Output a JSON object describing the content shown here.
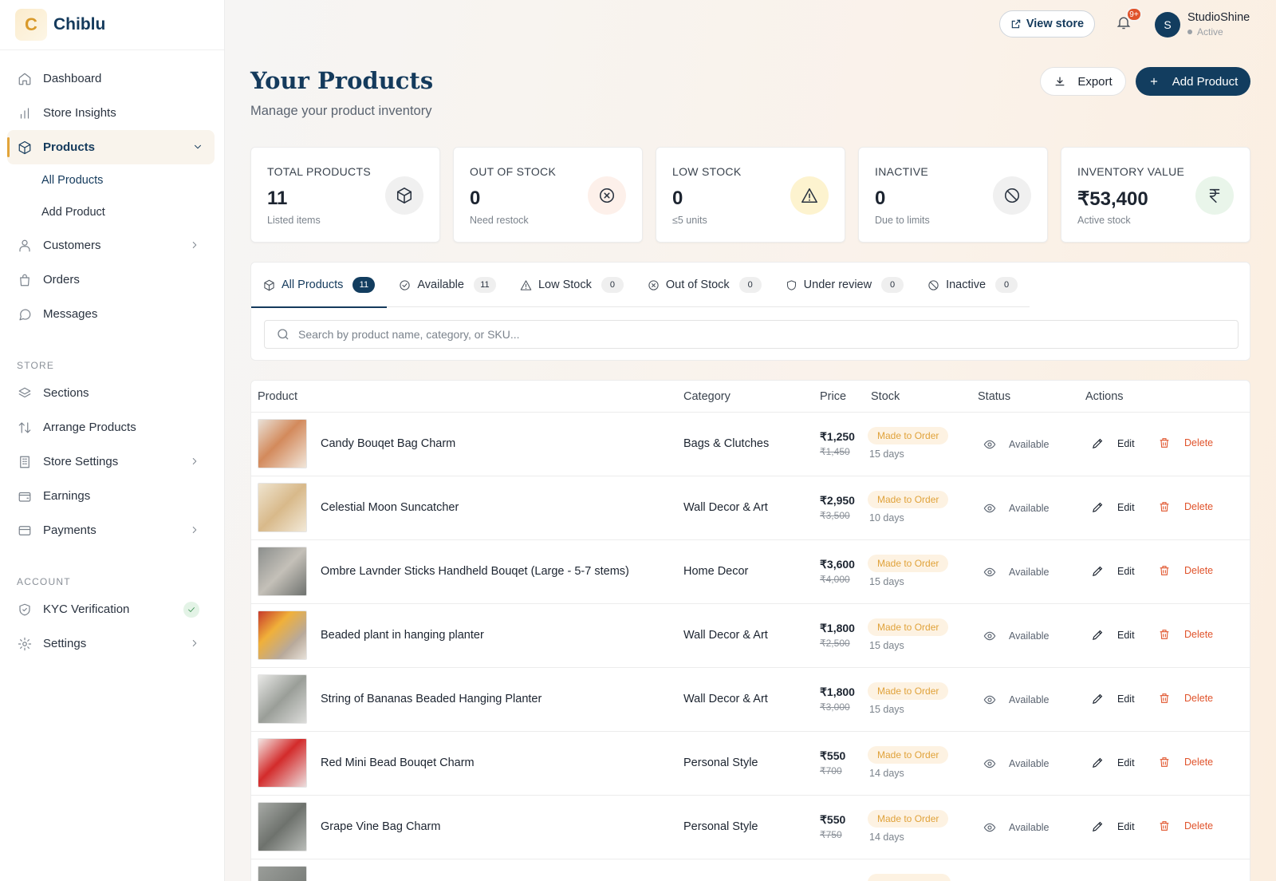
{
  "brand": {
    "logo_letter": "C",
    "name": "Chiblu"
  },
  "sidebar": {
    "items_main": [
      {
        "label": "Dashboard",
        "icon": "home-icon"
      },
      {
        "label": "Store Insights",
        "icon": "bar-chart-icon"
      }
    ],
    "products": {
      "label": "Products",
      "icon": "box-icon",
      "sub": [
        "All Products",
        "Add Product"
      ]
    },
    "items_main2": [
      {
        "label": "Customers",
        "icon": "users-icon"
      },
      {
        "label": "Orders",
        "icon": "bag-icon"
      },
      {
        "label": "Messages",
        "icon": "chat-icon"
      }
    ],
    "store_label": "STORE",
    "store_items": [
      {
        "label": "Sections",
        "icon": "layers-icon"
      },
      {
        "label": "Arrange Products",
        "icon": "sort-icon"
      },
      {
        "label": "Store Settings",
        "icon": "building-icon"
      },
      {
        "label": "Earnings",
        "icon": "wallet-icon"
      },
      {
        "label": "Payments",
        "icon": "card-icon"
      }
    ],
    "account_label": "ACCOUNT",
    "account_items": [
      {
        "label": "KYC Verification",
        "icon": "shield-icon"
      },
      {
        "label": "Settings",
        "icon": "gear-icon"
      }
    ]
  },
  "topbar": {
    "view_store": "View store",
    "notification_count": "9+",
    "avatar_letter": "S",
    "user_name": "StudioShine",
    "user_status": "Active"
  },
  "page": {
    "title": "Your Products",
    "subtitle": "Manage your product inventory",
    "export_label": "Export",
    "add_label": "Add Product"
  },
  "stats": [
    {
      "label": "TOTAL PRODUCTS",
      "value": "11",
      "note": "Listed items",
      "icon": "box-icon",
      "icon_bg": "#f0f0f0"
    },
    {
      "label": "OUT OF STOCK",
      "value": "0",
      "note": "Need restock",
      "icon": "x-circle-icon",
      "icon_bg": "#fdf0ea"
    },
    {
      "label": "LOW STOCK",
      "value": "0",
      "note": "≤5 units",
      "icon": "warning-icon",
      "icon_bg": "#fdf3cf"
    },
    {
      "label": "INACTIVE",
      "value": "0",
      "note": "Due to limits",
      "icon": "ban-icon",
      "icon_bg": "#f0f0f0"
    },
    {
      "label": "INVENTORY VALUE",
      "value": "₹53,400",
      "note": "Active stock",
      "icon": "rupee-icon",
      "icon_bg": "#e9f5ea"
    }
  ],
  "tabs": [
    {
      "label": "All Products",
      "count": "11",
      "icon": "box-icon"
    },
    {
      "label": "Available",
      "count": "11",
      "icon": "check-circle-icon"
    },
    {
      "label": "Low Stock",
      "count": "0",
      "icon": "warning-icon"
    },
    {
      "label": "Out of Stock",
      "count": "0",
      "icon": "x-circle-icon"
    },
    {
      "label": "Under review",
      "count": "0",
      "icon": "shield-icon"
    },
    {
      "label": "Inactive",
      "count": "0",
      "icon": "ban-icon"
    }
  ],
  "search": {
    "placeholder": "Search by product name, category, or SKU..."
  },
  "table": {
    "headers": {
      "product": "Product",
      "category": "Category",
      "price": "Price",
      "stock": "Stock",
      "status": "Status",
      "actions": "Actions"
    },
    "edit_label": "Edit",
    "delete_label": "Delete",
    "rows": [
      {
        "name": "Candy Bouqet Bag Charm",
        "category": "Bags & Clutches",
        "price": "₹1,250",
        "old_price": "₹1,450",
        "stock_badge": "Made to Order",
        "stock_days": "15 days",
        "status": "Available"
      },
      {
        "name": "Celestial Moon Suncatcher",
        "category": "Wall Decor & Art",
        "price": "₹2,950",
        "old_price": "₹3,500",
        "stock_badge": "Made to Order",
        "stock_days": "10 days",
        "status": "Available"
      },
      {
        "name": "Ombre Lavnder Sticks Handheld Bouqet (Large - 5-7 stems)",
        "category": "Home Decor",
        "price": "₹3,600",
        "old_price": "₹4,000",
        "stock_badge": "Made to Order",
        "stock_days": "15 days",
        "status": "Available"
      },
      {
        "name": "Beaded plant in hanging planter",
        "category": "Wall Decor & Art",
        "price": "₹1,800",
        "old_price": "₹2,500",
        "stock_badge": "Made to Order",
        "stock_days": "15 days",
        "status": "Available"
      },
      {
        "name": "String of Bananas Beaded Hanging Planter",
        "category": "Wall Decor & Art",
        "price": "₹1,800",
        "old_price": "₹3,000",
        "stock_badge": "Made to Order",
        "stock_days": "15 days",
        "status": "Available"
      },
      {
        "name": "Red Mini Bead Bouqet Charm",
        "category": "Personal Style",
        "price": "₹550",
        "old_price": "₹700",
        "stock_badge": "Made to Order",
        "stock_days": "14 days",
        "status": "Available"
      },
      {
        "name": "Grape Vine Bag Charm",
        "category": "Personal Style",
        "price": "₹550",
        "old_price": "₹750",
        "stock_badge": "Made to Order",
        "stock_days": "14 days",
        "status": "Available"
      }
    ]
  },
  "colors": {
    "primary": "#123d5f",
    "accent": "#e2a43a",
    "danger": "#e0532b",
    "badge_bg": "#fdf2e2",
    "badge_text": "#e0a23a"
  }
}
